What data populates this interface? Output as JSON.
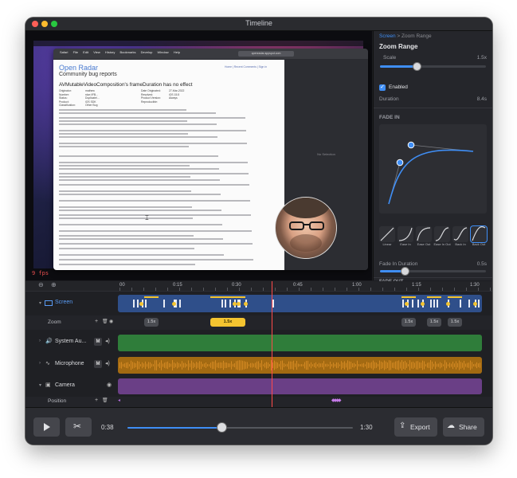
{
  "window": {
    "title": "Timeline"
  },
  "preview": {
    "fps": "9 fps",
    "screen_content": {
      "browser_menus": [
        "Safari",
        "File",
        "Edit",
        "View",
        "History",
        "Bookmarks",
        "Develop",
        "Window",
        "Help"
      ],
      "url": "openradar.appspot.com",
      "site_title": "Open Radar",
      "site_subtitle": "Community bug reports",
      "site_nav": "Home | Recent Comments | Sign in",
      "radar_title": "AVMutableVideoComposition's frameDuration has no effect",
      "meta_left": [
        "Originator:",
        "Number:",
        "Status:",
        "Product:",
        "Classification:"
      ],
      "meta_left_values": [
        "mathew",
        "rdar://FB...",
        "Duplicate/...",
        "iOS SDK",
        "Other Bug"
      ],
      "meta_right": [
        "Date Originated:",
        "Resolved:",
        "Product Version:",
        "Reproducible:"
      ],
      "meta_right_values": [
        "27-Mar-2022",
        "",
        "iOS 15.5",
        "Always"
      ],
      "no_selection": "No Selection"
    }
  },
  "panel": {
    "breadcrumb_root": "Screen",
    "breadcrumb_sep": ">",
    "breadcrumb_current": "Zoom Range",
    "section_title": "Zoom Range",
    "scale_label": "Scale",
    "scale_value": "1.5x",
    "scale_fraction": 0.35,
    "enabled_label": "Enabled",
    "enabled_check": "✓",
    "duration_label": "Duration",
    "duration_value": "8.4s",
    "fade_in_title": "FADE IN",
    "presets": [
      "Linear",
      "Ease In",
      "Ease Out",
      "Ease In Out",
      "Back In",
      "Back Out"
    ],
    "fade_in_duration_label": "Fade In Duration",
    "fade_in_duration_value": "0.5s",
    "fade_in_fraction": 0.24,
    "fade_out_title": "FADE OUT"
  },
  "timeline": {
    "ruler": [
      "00",
      "0:15",
      "0:30",
      "0:45",
      "1:00",
      "1:15",
      "1:30"
    ],
    "tracks": {
      "screen": "Screen",
      "zoom": "Zoom",
      "system_audio": "System Au...",
      "microphone": "Microphone",
      "camera": "Camera",
      "position": "Position"
    },
    "mute_label": "M",
    "zoom_chips": [
      "1.5x",
      "1.5x",
      "1.5x",
      "1.5x",
      "1.5x"
    ],
    "colors": {
      "screen": "#2f4f8a",
      "zoom_active": "#f4c430",
      "system_audio": "#2f7d3a",
      "microphone": "#a36a12",
      "camera": "#6a3f86",
      "playhead": "#ff4a4a",
      "accent": "#3f8ef5"
    }
  },
  "transport": {
    "current_time": "0:38",
    "total_time": "1:30",
    "progress": 0.42,
    "export_label": "Export",
    "share_label": "Share"
  }
}
